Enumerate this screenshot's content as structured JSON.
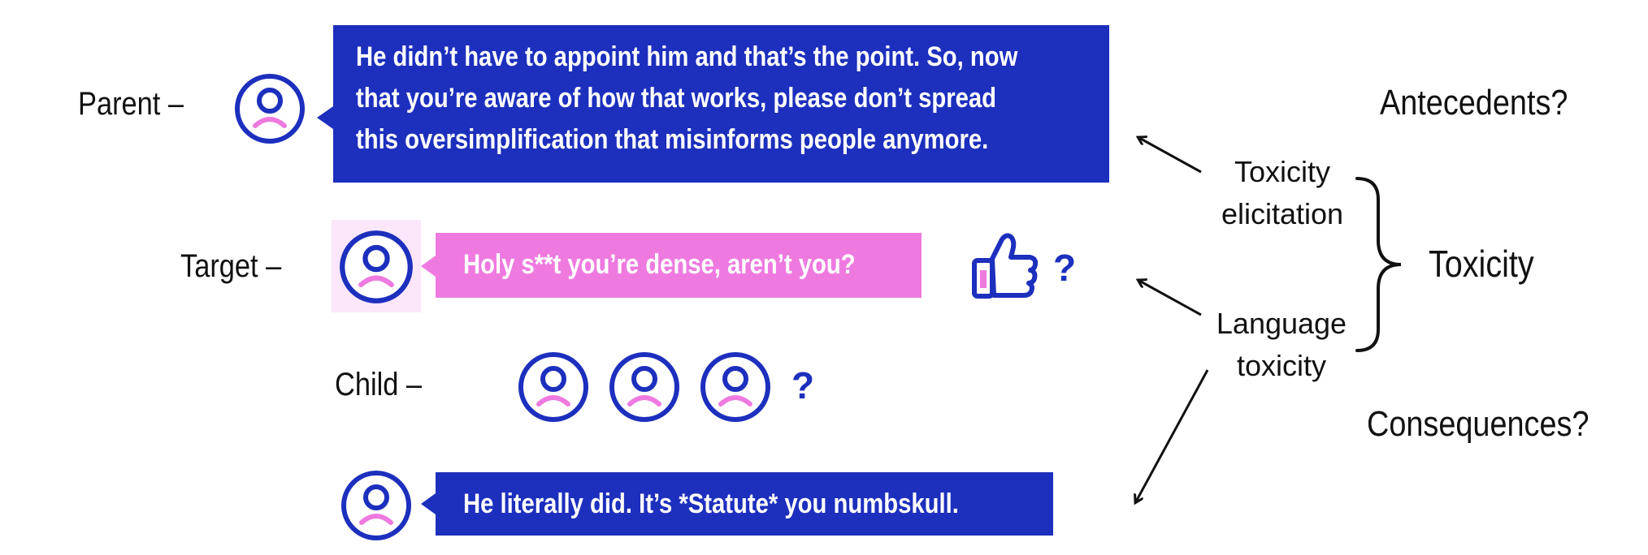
{
  "labels": {
    "parent": "Parent –",
    "target": "Target –",
    "child": "Child –"
  },
  "bubbles": {
    "parent_lines": [
      "He didn’t have to appoint him and that’s the point. So, now",
      "that you’re aware of how that works, please don’t spread",
      "this oversimplification that misinforms people anymore."
    ],
    "target": "Holy s**t you’re dense, aren’t you?",
    "child": "He literally did. It’s *Statute* you numbskull."
  },
  "marks": {
    "like_question": "?",
    "children_question": "?"
  },
  "right": {
    "antecedents": "Antecedents?",
    "elicitation_line1": "Toxicity",
    "elicitation_line2": "elicitation",
    "language_line1": "Language",
    "language_line2": "toxicity",
    "toxicity": "Toxicity",
    "consequences": "Consequences?"
  },
  "icons": {
    "avatar": "user-avatar-icon",
    "like": "thumbs-up-icon",
    "brace": "curly-brace-icon",
    "arrow": "arrow-icon"
  },
  "colors": {
    "blue": "#1d2fbd",
    "pink": "#ee7ae0",
    "text": "#111111"
  }
}
